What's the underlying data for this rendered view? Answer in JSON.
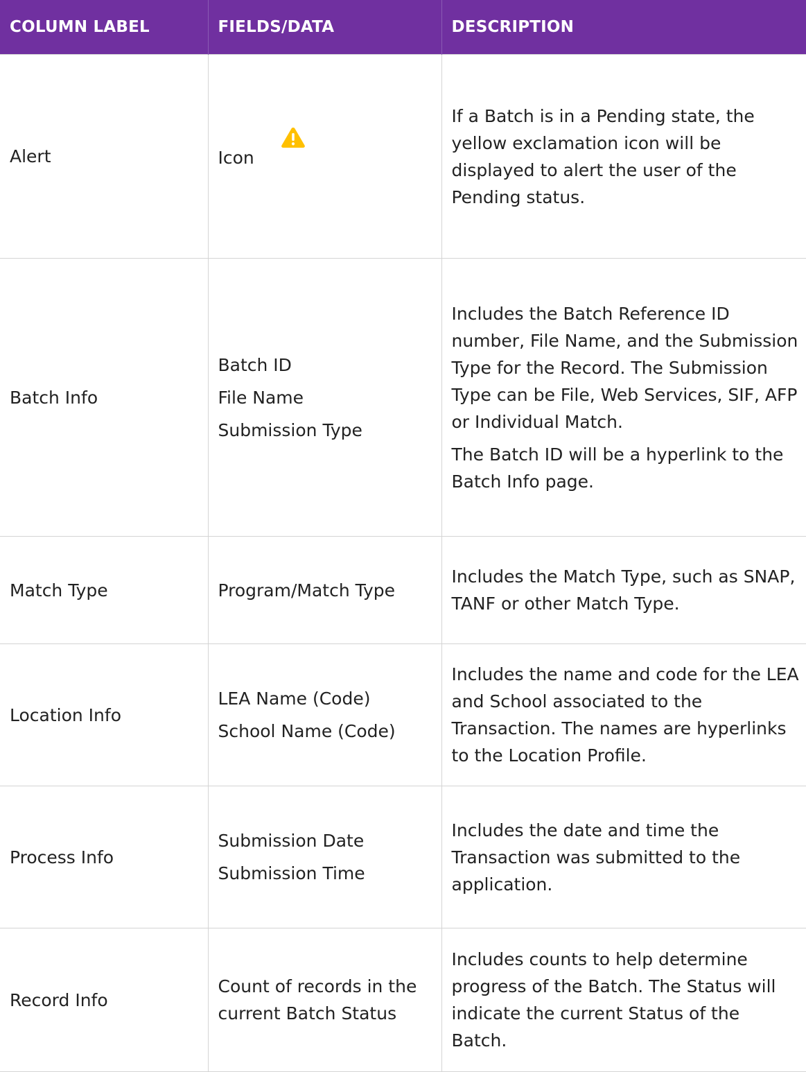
{
  "headers": {
    "column_label": "COLUMN LABEL",
    "fields_data": "FIELDS/DATA",
    "description": "DESCRIPTION"
  },
  "colors": {
    "header_bg": "#7030a0",
    "header_text": "#ffffff",
    "alert_icon": "#ffc000"
  },
  "rows": [
    {
      "label": "Alert",
      "fields": [
        "Icon"
      ],
      "field_icon": "warning-triangle-icon",
      "description": [
        "If a Batch is in a Pending state, the yellow exclamation icon will be displayed to alert the user of the Pending status."
      ]
    },
    {
      "label": "Batch Info",
      "fields": [
        "Batch ID",
        "File Name",
        "Submission Type"
      ],
      "description": [
        "Includes the Batch Reference ID number, File Name, and the Submission Type for the Record. The Submission Type can be File, Web Services, SIF, AFP or Individual Match.",
        "The Batch ID will be a hyperlink to the Batch Info page."
      ]
    },
    {
      "label": "Match Type",
      "fields": [
        "Program/Match Type"
      ],
      "description": [
        "Includes the Match Type, such as SNAP, TANF or other Match Type."
      ]
    },
    {
      "label": "Location Info",
      "fields": [
        "LEA Name (Code)",
        "School Name (Code)"
      ],
      "description": [
        "Includes the name and code for the LEA and School associated to the Transaction. The names are hyperlinks to the Location Profile."
      ]
    },
    {
      "label": "Process Info",
      "fields": [
        "Submission Date",
        "Submission Time"
      ],
      "description": [
        "Includes the date and time the Transaction was submitted to the application."
      ]
    },
    {
      "label": "Record Info",
      "fields": [
        "Count of records in the current Batch Status"
      ],
      "description": [
        "Includes counts to help determine progress of the Batch. The Status will indicate the current Status of the Batch."
      ]
    }
  ]
}
